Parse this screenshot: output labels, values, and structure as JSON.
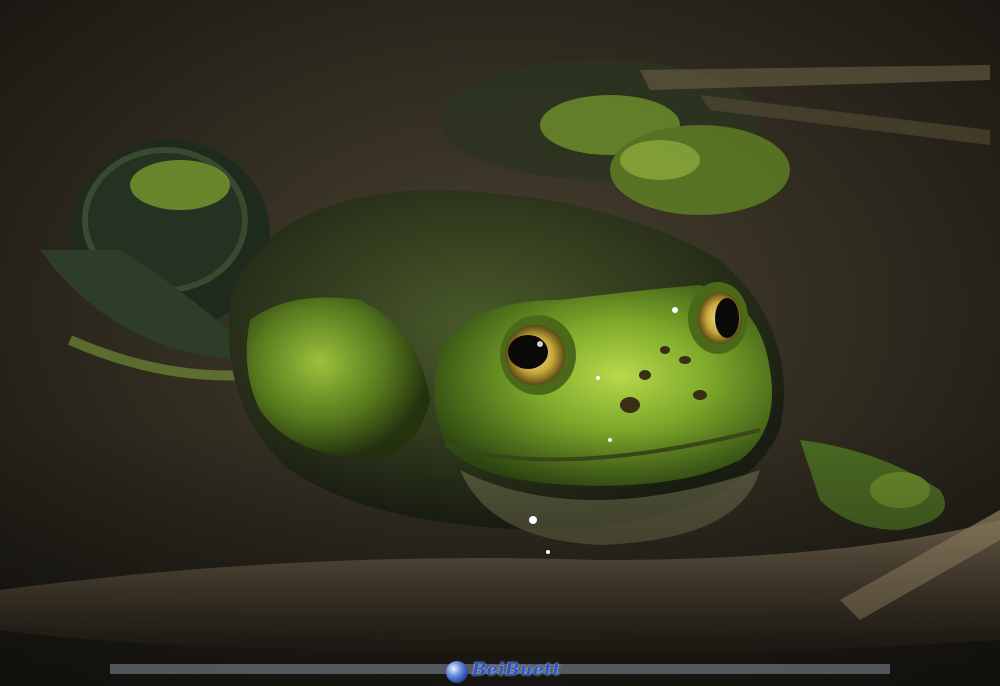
{
  "photo": {
    "subject": "green-frog",
    "watermark_text": "BeiBuett"
  },
  "colors": {
    "water_dark": "#1c1a12",
    "mud": "#4a4030",
    "frog_green": "#7aa82a",
    "frog_highlight": "#b6d84a",
    "eye_gold": "#c8a83a",
    "watermark_blue": "#2a56c8"
  }
}
